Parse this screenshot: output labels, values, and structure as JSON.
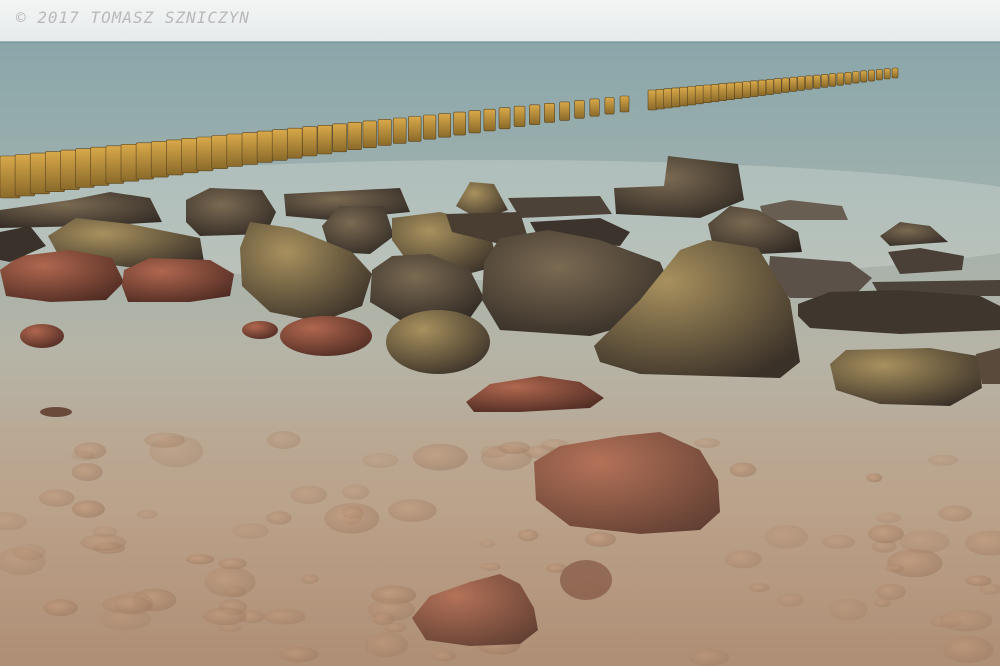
{
  "photo": {
    "watermark": "© 2017 TOMASZ SZNICZYN",
    "subject": "long-exposure-seascape",
    "colors": {
      "sky": "#eef1f2",
      "sea_far": "#8ea7aa",
      "sea_mid": "#a9b3ac",
      "shallows": "#b79c84",
      "groyne": "#c99a3e",
      "rock_dark": "#3e342d",
      "rock_lit": "#8a7a5a",
      "rock_red": "#8a4a3a"
    }
  }
}
